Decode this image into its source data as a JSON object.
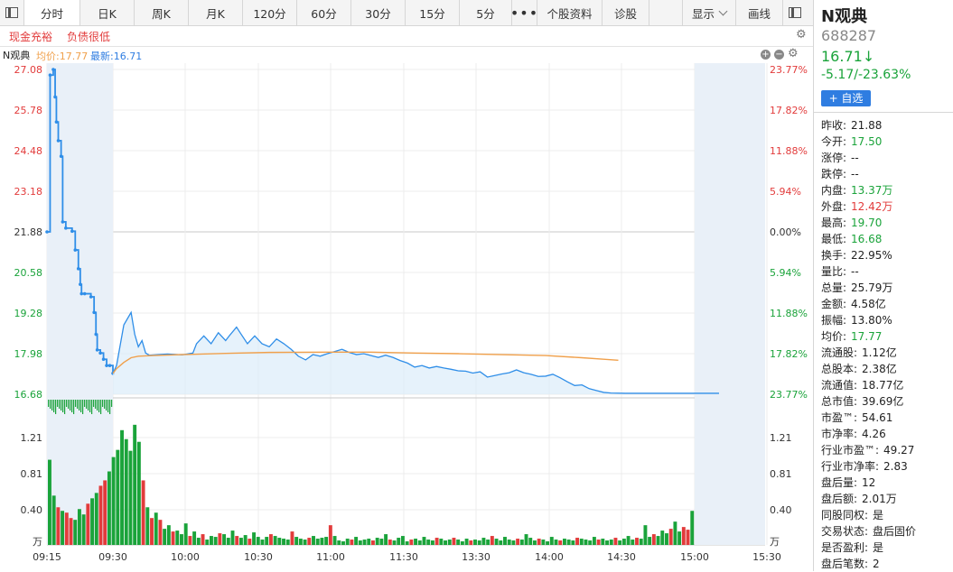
{
  "toolbar": {
    "tabs": [
      "分时",
      "日K",
      "周K",
      "月K",
      "120分",
      "60分",
      "30分",
      "15分",
      "5分"
    ],
    "more": "•••",
    "links": [
      "个股资料",
      "诊股"
    ],
    "display_label": "显示",
    "draw_label": "画线"
  },
  "tags": [
    "现金充裕",
    "负债很低"
  ],
  "info": {
    "name": "N观典",
    "avg_label": "均价:17.77",
    "last_label": "最新:16.71"
  },
  "colors": {
    "up": "#e23b3b",
    "down": "#1aa33a",
    "price_line": "#2f8ee8",
    "avg_line": "#f0a04b",
    "axis_text_blue": "#2f7de1"
  },
  "chart_data": {
    "type": "line",
    "x_ticks": [
      "09:15",
      "09:30",
      "10:00",
      "10:30",
      "11:00",
      "11:30",
      "13:30",
      "14:00",
      "14:30",
      "15:00",
      "15:30"
    ],
    "price_ticks": [
      "27.08",
      "25.78",
      "24.48",
      "23.18",
      "21.88",
      "20.58",
      "19.28",
      "17.98",
      "16.68"
    ],
    "pct_ticks": [
      "23.77%",
      "17.82%",
      "11.88%",
      "5.94%",
      "0.00%",
      "5.94%",
      "11.88%",
      "17.82%",
      "23.77%"
    ],
    "ylim": [
      16.68,
      27.08
    ],
    "prev_close": 21.88,
    "volume_ticks": [
      "1.21",
      "0.81",
      "0.40"
    ],
    "volume_unit": "万",
    "series": [
      {
        "name": "最新",
        "values": [
          [
            0,
            21.88
          ],
          [
            1,
            26.9
          ],
          [
            2,
            27.08
          ],
          [
            2.6,
            26.2
          ],
          [
            3,
            25.4
          ],
          [
            3.6,
            24.8
          ],
          [
            4.5,
            24.3
          ],
          [
            5,
            22.2
          ],
          [
            6,
            22.0
          ],
          [
            8,
            21.9
          ],
          [
            9,
            21.3
          ],
          [
            10,
            20.7
          ],
          [
            10.6,
            20.2
          ],
          [
            11,
            19.9
          ],
          [
            12,
            19.9
          ],
          [
            14,
            19.8
          ],
          [
            15,
            19.3
          ],
          [
            15.6,
            18.6
          ],
          [
            16,
            18.1
          ],
          [
            17,
            18.0
          ],
          [
            18,
            17.8
          ],
          [
            19,
            17.6
          ],
          [
            20,
            17.6
          ],
          [
            21,
            17.35
          ],
          [
            22,
            17.6
          ],
          [
            24,
            18.9
          ],
          [
            26,
            19.3
          ],
          [
            27,
            18.6
          ],
          [
            28,
            18.2
          ],
          [
            29,
            18.4
          ],
          [
            30,
            18.0
          ],
          [
            31,
            17.93
          ],
          [
            36,
            17.97
          ],
          [
            40,
            17.94
          ],
          [
            43,
            18.0
          ],
          [
            44,
            18.3
          ],
          [
            46,
            18.55
          ],
          [
            48,
            18.3
          ],
          [
            50,
            18.65
          ],
          [
            52,
            18.4
          ],
          [
            53,
            18.55
          ],
          [
            55,
            18.83
          ],
          [
            56,
            18.65
          ],
          [
            58,
            18.3
          ],
          [
            60,
            18.55
          ],
          [
            62,
            18.3
          ],
          [
            64,
            18.2
          ],
          [
            66,
            18.45
          ],
          [
            68,
            18.3
          ],
          [
            70,
            18.12
          ],
          [
            72,
            17.9
          ],
          [
            74,
            17.78
          ],
          [
            76,
            17.95
          ],
          [
            78,
            17.9
          ],
          [
            80,
            17.98
          ],
          [
            82,
            18.05
          ],
          [
            84,
            18.12
          ],
          [
            86,
            18.02
          ],
          [
            88,
            17.95
          ],
          [
            90,
            17.98
          ],
          [
            92,
            17.92
          ],
          [
            94,
            17.86
          ],
          [
            96,
            17.93
          ],
          [
            98,
            17.86
          ],
          [
            100,
            17.76
          ],
          [
            102,
            17.68
          ],
          [
            104,
            17.55
          ],
          [
            106,
            17.6
          ],
          [
            108,
            17.52
          ],
          [
            110,
            17.57
          ],
          [
            112,
            17.52
          ],
          [
            114,
            17.48
          ],
          [
            116,
            17.43
          ],
          [
            118,
            17.42
          ],
          [
            120,
            17.36
          ],
          [
            122,
            17.4
          ],
          [
            124,
            17.23
          ],
          [
            126,
            17.28
          ],
          [
            128,
            17.33
          ],
          [
            130,
            17.37
          ],
          [
            132,
            17.46
          ],
          [
            134,
            17.37
          ],
          [
            136,
            17.32
          ],
          [
            138,
            17.25
          ],
          [
            140,
            17.26
          ],
          [
            142,
            17.32
          ],
          [
            144,
            17.21
          ],
          [
            146,
            17.08
          ],
          [
            148,
            16.96
          ],
          [
            150,
            16.98
          ],
          [
            152,
            16.86
          ],
          [
            154,
            16.8
          ],
          [
            156,
            16.74
          ],
          [
            158,
            16.72
          ],
          [
            162,
            16.71
          ]
        ]
      },
      {
        "name": "均价",
        "values": [
          [
            21,
            17.35
          ],
          [
            22,
            17.5
          ],
          [
            24,
            17.7
          ],
          [
            26,
            17.85
          ],
          [
            28,
            17.9
          ],
          [
            32,
            17.92
          ],
          [
            40,
            17.95
          ],
          [
            52,
            17.99
          ],
          [
            64,
            18.02
          ],
          [
            80,
            18.03
          ],
          [
            92,
            18.03
          ],
          [
            104,
            18.0
          ],
          [
            116,
            17.98
          ],
          [
            128,
            17.95
          ],
          [
            140,
            17.92
          ],
          [
            150,
            17.85
          ],
          [
            156,
            17.8
          ],
          [
            160,
            17.77
          ]
        ]
      }
    ],
    "volume": [
      0.95,
      0.55,
      0.42,
      0.38,
      0.36,
      0.3,
      0.28,
      0.4,
      0.34,
      0.46,
      0.52,
      0.58,
      0.66,
      0.72,
      0.82,
      0.98,
      1.06,
      1.28,
      1.18,
      1.05,
      1.34,
      1.15,
      0.72,
      0.42,
      0.3,
      0.36,
      0.28,
      0.18,
      0.22,
      0.15,
      0.16,
      0.12,
      0.24,
      0.1,
      0.15,
      0.08,
      0.12,
      0.06,
      0.1,
      0.09,
      0.13,
      0.12,
      0.08,
      0.16,
      0.1,
      0.08,
      0.11,
      0.07,
      0.14,
      0.09,
      0.06,
      0.09,
      0.12,
      0.1,
      0.08,
      0.07,
      0.06,
      0.15,
      0.09,
      0.07,
      0.06,
      0.08,
      0.1,
      0.07,
      0.08,
      0.09,
      0.22,
      0.1,
      0.05,
      0.04,
      0.07,
      0.06,
      0.09,
      0.05,
      0.06,
      0.07,
      0.05,
      0.08,
      0.07,
      0.12,
      0.06,
      0.05,
      0.08,
      0.1,
      0.04,
      0.06,
      0.07,
      0.05,
      0.09,
      0.06,
      0.05,
      0.08,
      0.07,
      0.05,
      0.06,
      0.08,
      0.06,
      0.04,
      0.07,
      0.05,
      0.06,
      0.05,
      0.08,
      0.06,
      0.1,
      0.07,
      0.05,
      0.09,
      0.06,
      0.05,
      0.07,
      0.06,
      0.12,
      0.08,
      0.05,
      0.07,
      0.06,
      0.04,
      0.09,
      0.06,
      0.05,
      0.07,
      0.06,
      0.05,
      0.08,
      0.07,
      0.06,
      0.05,
      0.09,
      0.06,
      0.07,
      0.05,
      0.06,
      0.08,
      0.05,
      0.07,
      0.1,
      0.06,
      0.08,
      0.07,
      0.22,
      0.09,
      0.12,
      0.1,
      0.16,
      0.13,
      0.18,
      0.26,
      0.15,
      0.2,
      0.17,
      0.38
    ],
    "volume_up": [
      2,
      4,
      5,
      9,
      12,
      13,
      22,
      24,
      26,
      29,
      33,
      36,
      40,
      44,
      47,
      52,
      57,
      61,
      66,
      71,
      76,
      80,
      85,
      91,
      95,
      99,
      104,
      110,
      115,
      120,
      124,
      129,
      133,
      138,
      142,
      146,
      149,
      150
    ]
  },
  "panel": {
    "name": "N观典",
    "code": "688287",
    "price": "16.71",
    "arrow": "↓",
    "change": "-5.17/-23.63%",
    "add_btn": "+ 自选",
    "rows": [
      {
        "label": "昨收:",
        "value": "21.88",
        "color": ""
      },
      {
        "label": "今开:",
        "value": "17.50",
        "color": "green"
      },
      {
        "label": "涨停:",
        "value": "--",
        "color": ""
      },
      {
        "label": "跌停:",
        "value": "--",
        "color": ""
      },
      {
        "label": "内盘:",
        "value": "13.37万",
        "color": "green"
      },
      {
        "label": "外盘:",
        "value": "12.42万",
        "color": "red"
      },
      {
        "label": "最高:",
        "value": "19.70",
        "color": "green"
      },
      {
        "label": "最低:",
        "value": "16.68",
        "color": "green"
      },
      {
        "label": "换手:",
        "value": "22.95%",
        "color": ""
      },
      {
        "label": "量比:",
        "value": "--",
        "color": ""
      },
      {
        "label": "总量:",
        "value": "25.79万",
        "color": ""
      },
      {
        "label": "金额:",
        "value": "4.58亿",
        "color": ""
      },
      {
        "label": "振幅:",
        "value": "13.80%",
        "color": ""
      },
      {
        "label": "均价:",
        "value": "17.77",
        "color": "green"
      },
      {
        "label": "流通股:",
        "value": "1.12亿",
        "color": ""
      },
      {
        "label": "总股本:",
        "value": "2.38亿",
        "color": ""
      },
      {
        "label": "流通值:",
        "value": "18.77亿",
        "color": ""
      },
      {
        "label": "总市值:",
        "value": "39.69亿",
        "color": ""
      },
      {
        "label": "市盈™:",
        "value": "54.61",
        "color": ""
      },
      {
        "label": "市净率:",
        "value": "4.26",
        "color": ""
      },
      {
        "label": "行业市盈™:",
        "value": "49.27",
        "color": ""
      },
      {
        "label": "行业市净率:",
        "value": "2.83",
        "color": ""
      },
      {
        "label": "盘后量:",
        "value": "12",
        "color": ""
      },
      {
        "label": "盘后额:",
        "value": "2.01万",
        "color": ""
      },
      {
        "label": "同股同权:",
        "value": "是",
        "color": ""
      },
      {
        "label": "交易状态:",
        "value": "盘后固价",
        "color": ""
      },
      {
        "label": "是否盈利:",
        "value": "是",
        "color": ""
      },
      {
        "label": "盘后笔数:",
        "value": "2",
        "color": ""
      }
    ]
  }
}
